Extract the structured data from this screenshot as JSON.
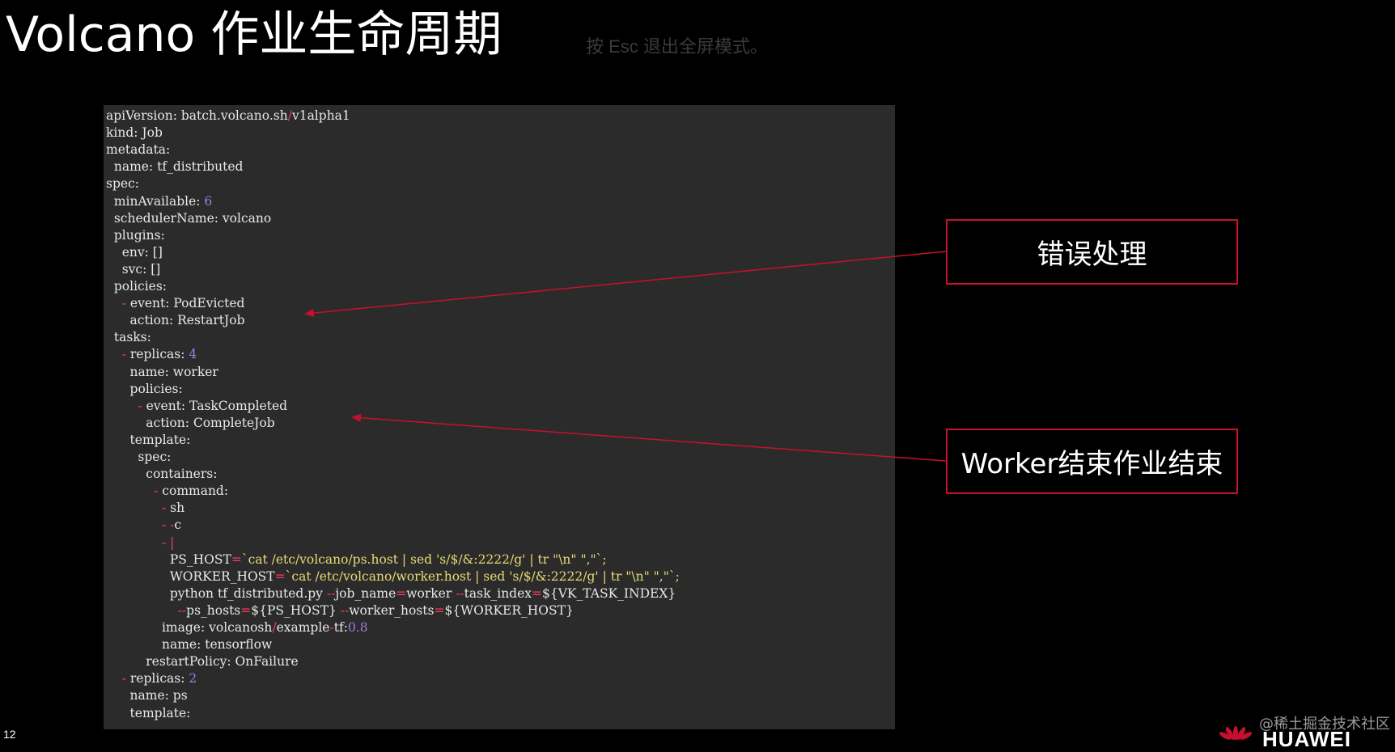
{
  "slide": {
    "title": "Volcano 作业生命周期",
    "esc_hint": "按 Esc 退出全屏模式。",
    "page_number": "12",
    "watermark": "@稀土掘金技术社区",
    "logo_text": "HUAWEI"
  },
  "callouts": {
    "error_handling": "错误处理",
    "worker_finish": "Worker结束作业结束"
  },
  "colors": {
    "background": "#000000",
    "code_background": "#2b2b2b",
    "accent_red": "#c8102e",
    "number_purple": "#9f7de0",
    "punct_red": "#ff3b5c",
    "string_yellow": "#e6db74"
  },
  "code": {
    "lines": [
      [
        {
          "t": "apiVersion: batch.volcano.sh",
          "c": "k"
        },
        {
          "t": "/",
          "c": "p"
        },
        {
          "t": "v1alpha1",
          "c": "v"
        }
      ],
      [
        {
          "t": "kind: Job",
          "c": "k"
        }
      ],
      [
        {
          "t": "metadata:",
          "c": "k"
        }
      ],
      [
        {
          "t": "  name: tf_distributed",
          "c": "k"
        }
      ],
      [
        {
          "t": "spec:",
          "c": "k"
        }
      ],
      [
        {
          "t": "  minAvailable: ",
          "c": "k"
        },
        {
          "t": "6",
          "c": "n"
        }
      ],
      [
        {
          "t": "  schedulerName: volcano",
          "c": "k"
        }
      ],
      [
        {
          "t": "  plugins:",
          "c": "k"
        }
      ],
      [
        {
          "t": "    env: []",
          "c": "k"
        }
      ],
      [
        {
          "t": "    svc: []",
          "c": "k"
        }
      ],
      [
        {
          "t": "  policies:",
          "c": "k"
        }
      ],
      [
        {
          "t": "    ",
          "c": "k"
        },
        {
          "t": "-",
          "c": "p"
        },
        {
          "t": " event: PodEvicted",
          "c": "k"
        }
      ],
      [
        {
          "t": "      action: RestartJob",
          "c": "k"
        }
      ],
      [
        {
          "t": "  tasks:",
          "c": "k"
        }
      ],
      [
        {
          "t": "    ",
          "c": "k"
        },
        {
          "t": "-",
          "c": "p"
        },
        {
          "t": " replicas: ",
          "c": "k"
        },
        {
          "t": "4",
          "c": "n"
        }
      ],
      [
        {
          "t": "      name: worker",
          "c": "k"
        }
      ],
      [
        {
          "t": "      policies:",
          "c": "k"
        }
      ],
      [
        {
          "t": "        ",
          "c": "k"
        },
        {
          "t": "-",
          "c": "p"
        },
        {
          "t": " event: TaskCompleted",
          "c": "k"
        }
      ],
      [
        {
          "t": "          action: CompleteJob",
          "c": "k"
        }
      ],
      [
        {
          "t": "      template:",
          "c": "k"
        }
      ],
      [
        {
          "t": "        spec:",
          "c": "k"
        }
      ],
      [
        {
          "t": "          containers:",
          "c": "k"
        }
      ],
      [
        {
          "t": "            ",
          "c": "k"
        },
        {
          "t": "-",
          "c": "p"
        },
        {
          "t": " command:",
          "c": "k"
        }
      ],
      [
        {
          "t": "              ",
          "c": "k"
        },
        {
          "t": "-",
          "c": "p"
        },
        {
          "t": " sh",
          "c": "k"
        }
      ],
      [
        {
          "t": "              ",
          "c": "k"
        },
        {
          "t": "- -",
          "c": "p"
        },
        {
          "t": "c",
          "c": "k"
        }
      ],
      [
        {
          "t": "              ",
          "c": "k"
        },
        {
          "t": "- |",
          "c": "p"
        }
      ],
      [
        {
          "t": "                PS_HOST",
          "c": "k"
        },
        {
          "t": "=",
          "c": "p"
        },
        {
          "t": "`cat /etc/volcano/ps.host | sed 's/$/&:2222/g' | tr \"\\n\" \",\"`;",
          "c": "s"
        }
      ],
      [
        {
          "t": "                WORKER_HOST",
          "c": "k"
        },
        {
          "t": "=",
          "c": "p"
        },
        {
          "t": "`cat /etc/volcano/worker.host | sed 's/$/&:2222/g' | tr \"\\n\" \",\"`;",
          "c": "s"
        }
      ],
      [
        {
          "t": "                python tf_distributed.py ",
          "c": "k"
        },
        {
          "t": "--",
          "c": "p"
        },
        {
          "t": "job_name",
          "c": "k"
        },
        {
          "t": "=",
          "c": "p"
        },
        {
          "t": "worker ",
          "c": "k"
        },
        {
          "t": "--",
          "c": "p"
        },
        {
          "t": "task_index",
          "c": "k"
        },
        {
          "t": "=",
          "c": "p"
        },
        {
          "t": "${VK_TASK_INDEX}",
          "c": "k"
        }
      ],
      [
        {
          "t": "                  ",
          "c": "k"
        },
        {
          "t": "--",
          "c": "p"
        },
        {
          "t": "ps_hosts",
          "c": "k"
        },
        {
          "t": "=",
          "c": "p"
        },
        {
          "t": "${PS_HOST} ",
          "c": "k"
        },
        {
          "t": "--",
          "c": "p"
        },
        {
          "t": "worker_hosts",
          "c": "k"
        },
        {
          "t": "=",
          "c": "p"
        },
        {
          "t": "${WORKER_HOST}",
          "c": "k"
        }
      ],
      [
        {
          "t": "              image: volcanosh",
          "c": "k"
        },
        {
          "t": "/",
          "c": "p"
        },
        {
          "t": "example",
          "c": "k"
        },
        {
          "t": "-",
          "c": "p"
        },
        {
          "t": "tf:",
          "c": "k"
        },
        {
          "t": "0.8",
          "c": "n"
        }
      ],
      [
        {
          "t": "              name: tensorflow",
          "c": "k"
        }
      ],
      [
        {
          "t": "          restartPolicy: OnFailure",
          "c": "k"
        }
      ],
      [
        {
          "t": "    ",
          "c": "k"
        },
        {
          "t": "-",
          "c": "p"
        },
        {
          "t": " replicas: ",
          "c": "k"
        },
        {
          "t": "2",
          "c": "n"
        }
      ],
      [
        {
          "t": "      name: ps",
          "c": "k"
        }
      ],
      [
        {
          "t": "      template:",
          "c": "k"
        }
      ]
    ]
  }
}
